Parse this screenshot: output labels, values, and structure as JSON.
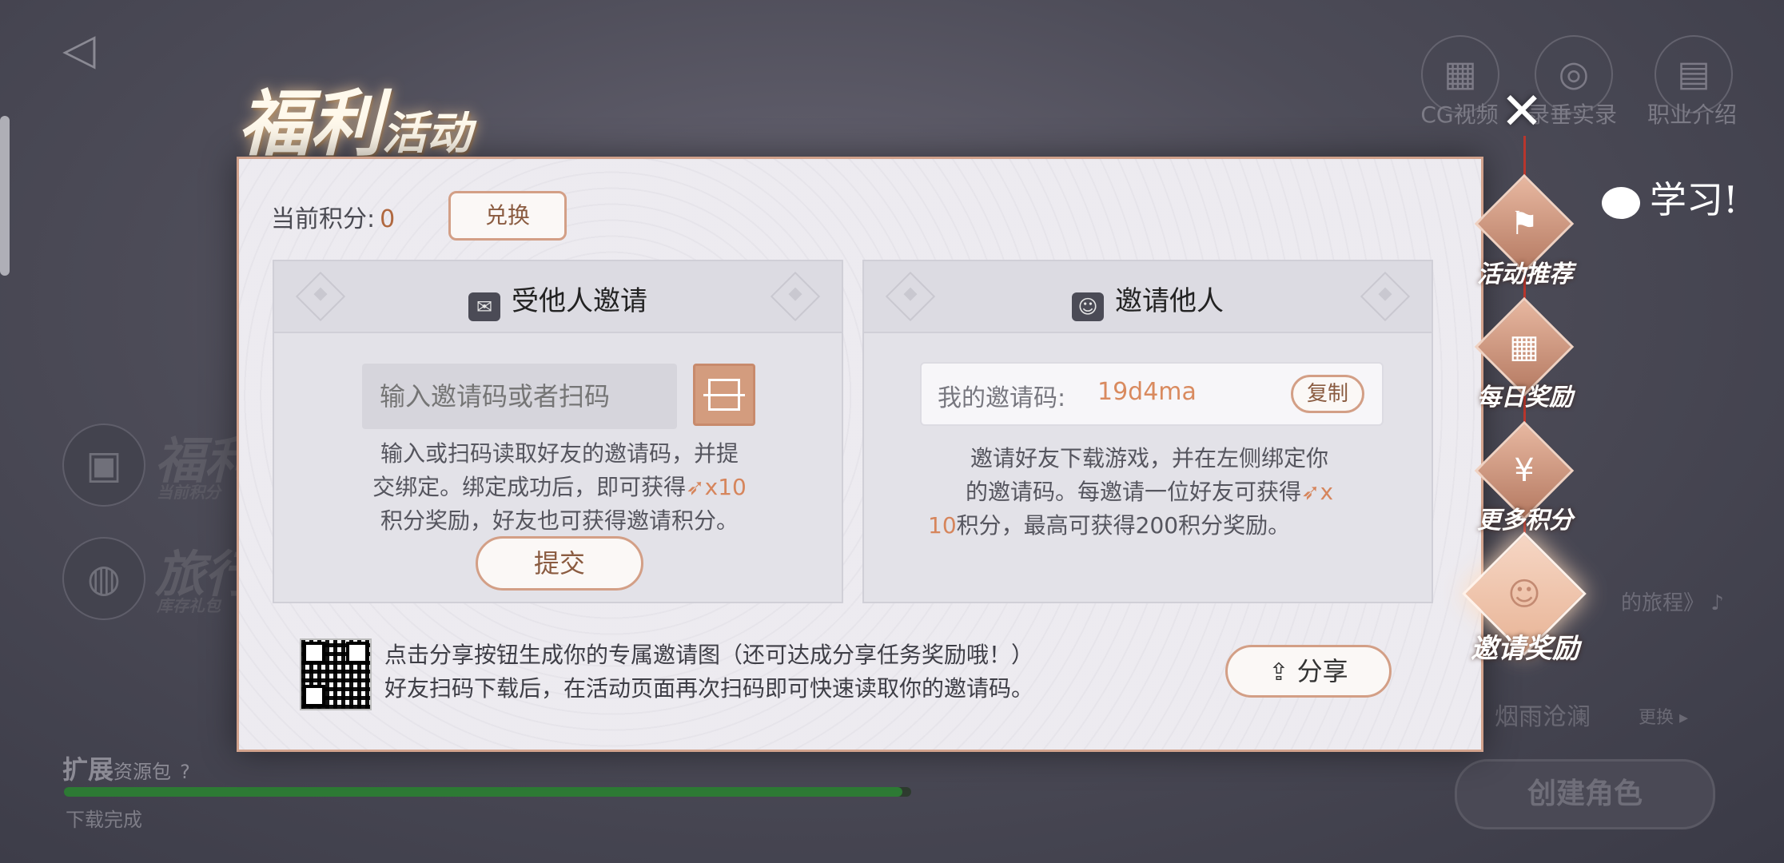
{
  "background": {
    "top_icons": [
      {
        "icon": "film-icon",
        "label": "CG视频"
      },
      {
        "icon": "reel-icon",
        "label": "录垂实录"
      },
      {
        "icon": "book-icon",
        "label": "职业介绍"
      }
    ],
    "left_entries": [
      {
        "title": "福利",
        "subtitle": "当前积分"
      },
      {
        "title": "旅行",
        "subtitle": "库存礼包"
      }
    ],
    "journey_text": "的旅程》",
    "expand_title": "扩展",
    "expand_subtitle": "资源包",
    "progress_fraction": 0.99,
    "download_status": "下载完成",
    "server_name": "烟雨沧澜",
    "change_label": "更换",
    "create_role": "创建角色"
  },
  "title": {
    "big": "福利",
    "small": "活动"
  },
  "points": {
    "label": "当前积分:",
    "value": "0",
    "exchange_label": "兑换"
  },
  "invited_card": {
    "title": "受他人邀请",
    "input_placeholder": "输入邀请码或者扫码",
    "desc_line1": "输入或扫码读取好友的邀请码，并提",
    "desc_line2a": "交绑定。绑定成功后，即可获得",
    "desc_reward": "x10",
    "desc_line3": "积分奖励，好友也可获得邀请积分。",
    "submit_label": "提交"
  },
  "invite_card": {
    "title": "邀请他人",
    "code_label": "我的邀请码:",
    "code_value": "19d4ma",
    "copy_label": "复制",
    "desc_line1": "邀请好友下载游戏，并在左侧绑定你",
    "desc_line2a": "的邀请码。每邀请一位好友可获得",
    "desc_reward_a": "x",
    "desc_reward_b": "10",
    "desc_line3": "积分，最高可获得200积分奖励。"
  },
  "share": {
    "line1": "点击分享按钮生成你的专属邀请图（还可达成分享任务奖励哦！）",
    "line2": "好友扫码下载后，在活动页面再次扫码即可快速读取你的邀请码。",
    "button_label": "分享"
  },
  "nav": [
    {
      "label": "活动推荐",
      "icon": "flag-icon"
    },
    {
      "label": "每日奖励",
      "icon": "calendar-icon"
    },
    {
      "label": "更多积分",
      "icon": "money-bag-icon"
    },
    {
      "label": "邀请奖励",
      "icon": "add-user-icon"
    }
  ],
  "study_text": "学习!"
}
